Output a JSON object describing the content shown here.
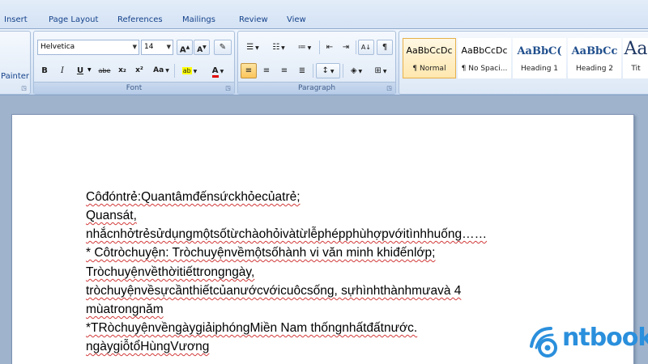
{
  "ribbon_tabs": [
    "Insert",
    "Page Layout",
    "References",
    "Mailings",
    "Review",
    "View"
  ],
  "clipboard": {
    "painter_label": "Painter"
  },
  "font_group": {
    "label": "Font",
    "font_name": "Helvetica",
    "font_size": "14",
    "grow_label": "A",
    "shrink_label": "A",
    "bold": "B",
    "italic": "I",
    "underline": "U",
    "strikethrough": "abe",
    "subscript": "x₂",
    "superscript": "x²",
    "change_case": "Aa",
    "highlight": "ab",
    "font_color": "A"
  },
  "paragraph_group": {
    "label": "Paragraph"
  },
  "styles": [
    {
      "sample": "AaBbCcDc",
      "name": "¶ Normal",
      "selected": true
    },
    {
      "sample": "AaBbCcDc",
      "name": "¶ No Spaci...",
      "selected": false
    },
    {
      "sample": "AaBbC(",
      "name": "Heading 1",
      "selected": false
    },
    {
      "sample": "AaBbCc",
      "name": "Heading 2",
      "selected": false
    },
    {
      "sample": "Aa",
      "name": "Tit",
      "selected": false
    }
  ],
  "document": {
    "lines": [
      "Côđóntrẻ:Quantâmđếnsứckhỏecủatrẻ;",
      "Quansát,",
      "nhắcnhởtrẻsửdụngmộtsốtừchàohỏivàtừlễphépphùhợpvớitìnhhuống……",
      "* Côtròchuyện: Tròchuyệnvềmộtsốhành vi văn minh khiđếnlớp;",
      "Tròchuyệnvềthờitiếttrongngày,",
      "tròchuyệnvềsựcầnthiếtcủanướcvớicuôcsống, sựhìnhthànhmưavà 4",
      "mùatrongnăm",
      "*TRòchuyệnvềngàygiảiphóngMiền Nam thốngnhấtđấtnước.",
      "ngàygiỗtổHùngVương"
    ]
  },
  "watermark": {
    "brand": "ntbook",
    "color": "#2a8fdc"
  }
}
